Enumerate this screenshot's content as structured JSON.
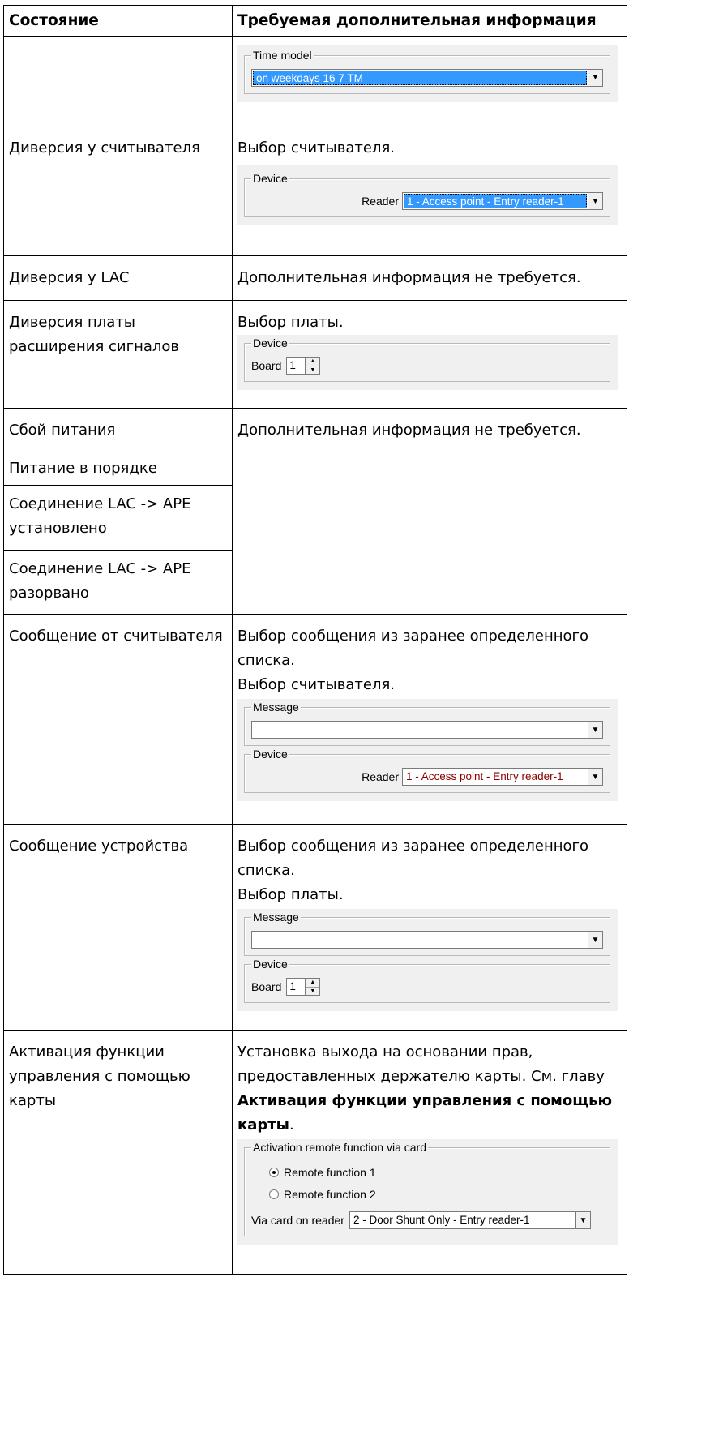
{
  "header": {
    "col1": "Состояние",
    "col2": "Требуемая дополнительная информация"
  },
  "rows": {
    "r0": {
      "time_model_legend": "Time model",
      "time_model_value": "on weekdays 16 7 TM"
    },
    "r1": {
      "state": "Диверсия у считывателя",
      "info": "Выбор считывателя.",
      "device_legend": "Device",
      "reader_label": "Reader",
      "reader_value": "1 - Access point - Entry reader-1"
    },
    "r2": {
      "state": "Диверсия у LAC",
      "info": "Дополнительная информация не требуется."
    },
    "r3": {
      "state": "Диверсия платы расширения сигналов",
      "info": "Выбор платы.",
      "device_legend": "Device",
      "board_label": "Board",
      "board_value": "1"
    },
    "r4": {
      "states": [
        "Сбой питания",
        "Питание в порядке",
        "Соединение LAC -> APE установлено",
        "Соединение LAC -> APE разорвано"
      ],
      "info": "Дополнительная информация не требуется."
    },
    "r5": {
      "state": "Сообщение от считывателя",
      "info1": "Выбор сообщения из заранее определенного списка.",
      "info2": "Выбор считывателя.",
      "message_legend": "Message",
      "message_value": "",
      "device_legend": "Device",
      "reader_label": "Reader",
      "reader_value": "1 - Access point - Entry reader-1"
    },
    "r6": {
      "state": "Сообщение устройства",
      "info1": "Выбор сообщения из заранее определенного списка.",
      "info2": "Выбор платы.",
      "message_legend": "Message",
      "message_value": "",
      "device_legend": "Device",
      "board_label": "Board",
      "board_value": "1"
    },
    "r7": {
      "state": "Активация функции управления с помощью карты",
      "info_pre": "Установка выхода на основании прав, предоставленных держателю карты. См. главу ",
      "info_bold": "Активация функции управления с помощью карты",
      "info_post": ".",
      "group_legend": "Activation remote function via card",
      "radio1": "Remote function  1",
      "radio2": "Remote function 2",
      "via_label": "Via card on reader",
      "via_value": "2 - Door Shunt Only - Entry reader-1"
    }
  },
  "icons": {
    "dropdown_arrow": "▼",
    "spin_up": "▲",
    "spin_down": "▼"
  }
}
